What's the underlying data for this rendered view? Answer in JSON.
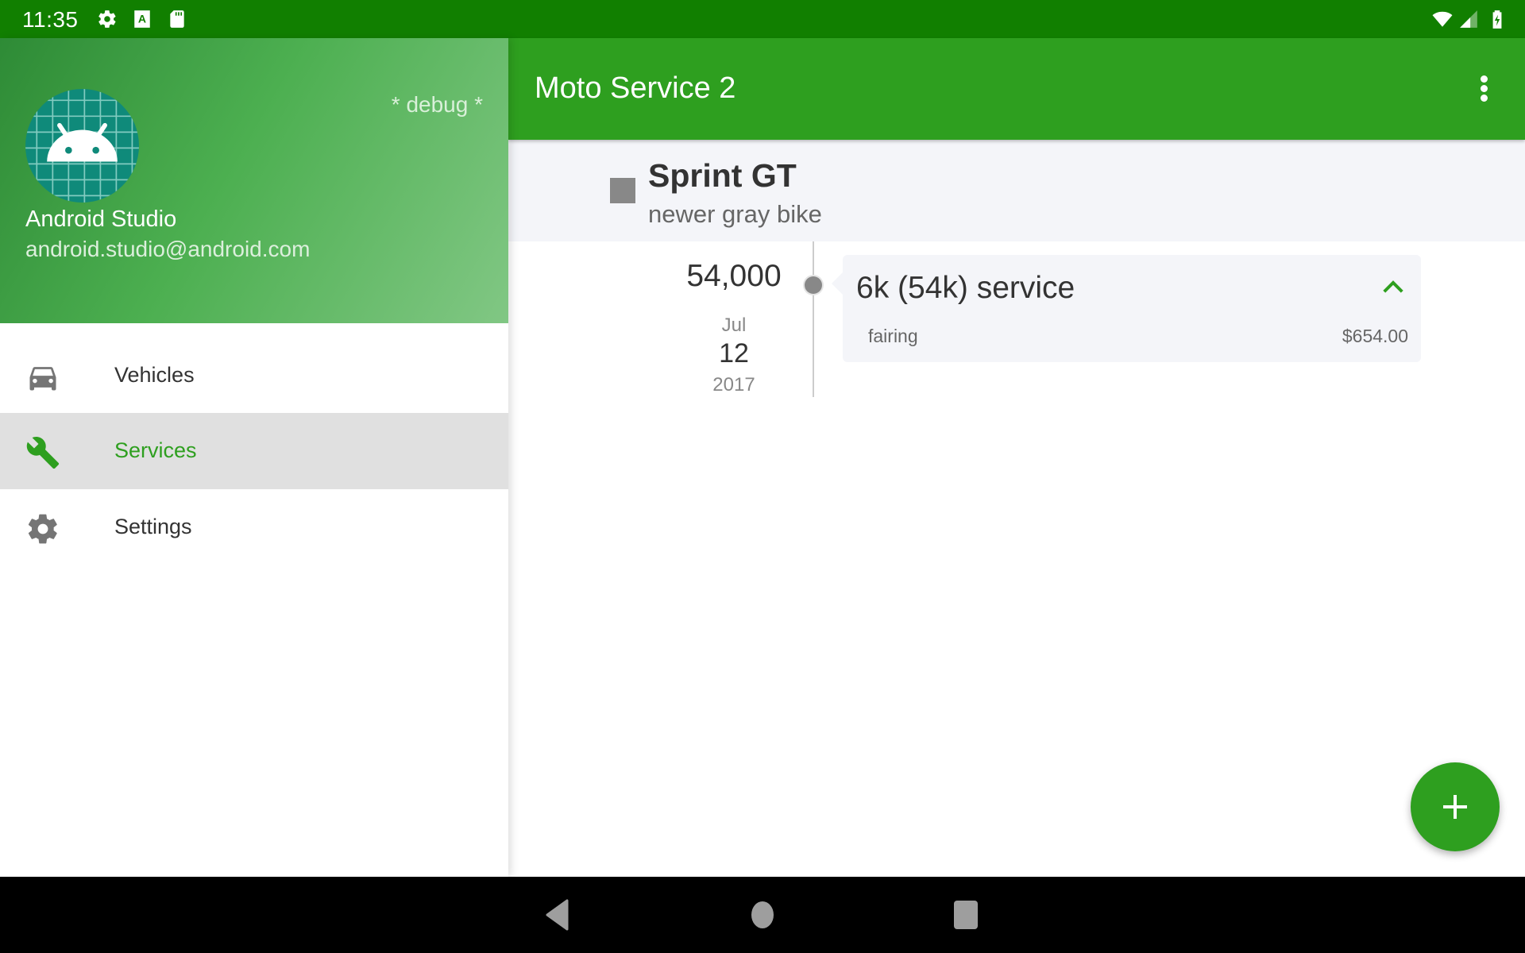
{
  "status_bar": {
    "time": "11:35",
    "left_icons": [
      "settings-icon",
      "keyboard-a-icon",
      "sd-card-icon"
    ],
    "right_icons": [
      "wifi-icon",
      "cell-signal-icon",
      "battery-charging-icon"
    ]
  },
  "app_bar": {
    "title": "Moto Service 2",
    "overflow_icon": "more-vert-icon"
  },
  "drawer": {
    "debug_label": "* debug *",
    "user_name": "Android Studio",
    "user_email": "android.studio@android.com",
    "items": [
      {
        "label": "Vehicles",
        "icon": "car-icon",
        "active": false
      },
      {
        "label": "Services",
        "icon": "wrench-icon",
        "active": true
      },
      {
        "label": "Settings",
        "icon": "gear-icon",
        "active": false
      }
    ]
  },
  "vehicle": {
    "name": "Sprint GT",
    "description": "newer gray bike",
    "color": "#888888"
  },
  "services": [
    {
      "odometer": "54,000",
      "month": "Jul",
      "day": "12",
      "year": "2017",
      "title": "6k (54k) service",
      "expanded": true,
      "line_items": [
        {
          "name": "fairing",
          "cost": "$654.00"
        }
      ]
    }
  ],
  "fab": {
    "icon": "add-icon",
    "label": "+"
  },
  "colors": {
    "primary": "#2e9f1f",
    "primary_dark": "#117f00",
    "active_item_bg": "#e0e0e0"
  },
  "system_nav": [
    "back-button",
    "home-button",
    "recents-button"
  ]
}
